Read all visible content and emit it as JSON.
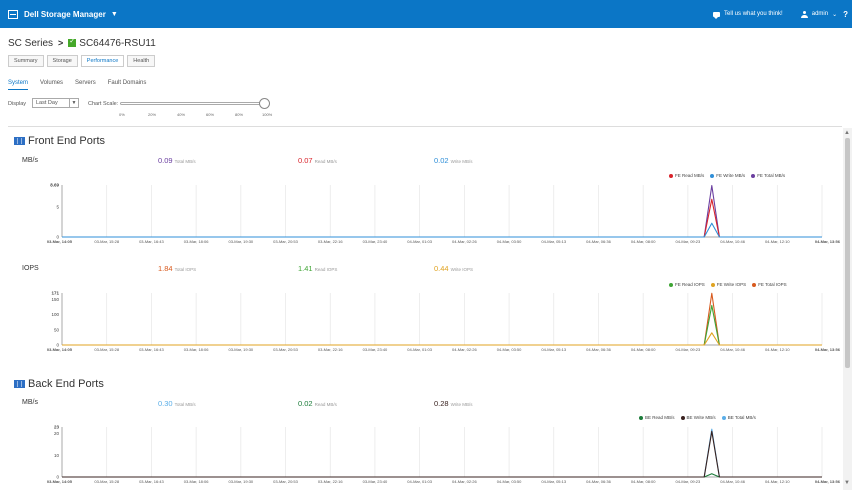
{
  "topbar": {
    "app_title": "Dell Storage Manager",
    "feedback_label": "Tell us what you think!",
    "user_label": "admin",
    "help_label": "?"
  },
  "breadcrumb": {
    "root": "SC Series",
    "system": "SC64476-RSU11"
  },
  "tabs": [
    "Summary",
    "Storage",
    "Performance",
    "Health"
  ],
  "active_tab": "Performance",
  "subtabs": [
    "System",
    "Volumes",
    "Servers",
    "Fault Domains"
  ],
  "active_subtab": "System",
  "controls": {
    "display_label": "Display",
    "display_value": "Last Day",
    "chart_scale_label": "Chart Scale:",
    "scale_ticks": [
      "0%",
      "20%",
      "40%",
      "60%",
      "80%",
      "100%"
    ],
    "scale_value": 1.0
  },
  "sections": {
    "front_end": {
      "title": "Front End Ports"
    },
    "back_end": {
      "title": "Back End Ports"
    }
  },
  "metrics": {
    "fe_mbs": {
      "label": "MB/s",
      "total": "0.09",
      "total_unit": "Total MB/s",
      "read": "0.07",
      "read_unit": "Read MB/s",
      "write": "0.02",
      "write_unit": "Write MB/s"
    },
    "fe_iops": {
      "label": "IOPS",
      "total": "1.84",
      "total_unit": "Total IOPS",
      "read": "1.41",
      "read_unit": "Read IOPS",
      "write": "0.44",
      "write_unit": "Write IOPS"
    },
    "be_mbs": {
      "label": "MB/s",
      "total": "0.30",
      "total_unit": "Total MB/s",
      "read": "0.02",
      "read_unit": "Read MB/s",
      "write": "0.28",
      "write_unit": "Write MB/s"
    }
  },
  "colors": {
    "brand": "#0b76c6",
    "fe_read": "#d9232b",
    "fe_write": "#2f8fd8",
    "fe_total": "#6b3fa0",
    "iops_read": "#3fa535",
    "iops_write": "#e0a321",
    "iops_total": "#d85a1e",
    "be_read": "#1c7c3a",
    "be_write": "#3a2320",
    "be_total": "#5aaee8"
  },
  "chart_data": [
    {
      "type": "line",
      "ylabel": "MB/s",
      "ylim": [
        0,
        8.69
      ],
      "yticks": [
        "8.69",
        "5",
        "0"
      ],
      "ytick_values": [
        8.69,
        5,
        0
      ],
      "x_ticks": [
        "03-Mar, 14:05",
        "03-Mar, 15:28",
        "03-Mar, 16:43",
        "03-Mar, 18:06",
        "03-Mar, 19:30",
        "03-Mar, 20:53",
        "03-Mar, 22:16",
        "03-Mar, 23:40",
        "04-Mar, 01:03",
        "04-Mar, 02:26",
        "04-Mar, 03:50",
        "04-Mar, 05:13",
        "04-Mar, 06:36",
        "04-Mar, 08:00",
        "04-Mar, 09:23",
        "04-Mar, 10:46",
        "04-Mar, 12:10",
        "04-Mar, 13:56"
      ],
      "series": [
        {
          "name": "FE Read MB/s",
          "color_key": "fe_read",
          "points": [
            [
              0,
              0
            ],
            [
              0.845,
              0
            ],
            [
              0.855,
              6.3
            ],
            [
              0.865,
              0
            ],
            [
              1,
              0
            ]
          ]
        },
        {
          "name": "FE Write MB/s",
          "color_key": "fe_write",
          "points": [
            [
              0,
              0
            ],
            [
              0.845,
              0
            ],
            [
              0.855,
              2.3
            ],
            [
              0.865,
              0
            ],
            [
              1,
              0
            ]
          ]
        },
        {
          "name": "FE Total MB/s",
          "color_key": "fe_total",
          "points": [
            [
              0,
              0
            ],
            [
              0.845,
              0
            ],
            [
              0.855,
              8.6
            ],
            [
              0.865,
              0
            ],
            [
              1,
              0
            ]
          ]
        }
      ]
    },
    {
      "type": "line",
      "ylabel": "IOPS",
      "ylim": [
        0,
        171
      ],
      "yticks": [
        "171",
        "150",
        "100",
        "50",
        "0"
      ],
      "ytick_values": [
        171,
        150,
        100,
        50,
        0
      ],
      "x_ticks": [
        "03-Mar, 14:05",
        "03-Mar, 15:28",
        "03-Mar, 16:43",
        "03-Mar, 18:06",
        "03-Mar, 19:30",
        "03-Mar, 20:53",
        "03-Mar, 22:16",
        "03-Mar, 23:40",
        "04-Mar, 01:03",
        "04-Mar, 02:26",
        "04-Mar, 03:50",
        "04-Mar, 05:13",
        "04-Mar, 06:36",
        "04-Mar, 08:00",
        "04-Mar, 09:23",
        "04-Mar, 10:46",
        "04-Mar, 12:10",
        "04-Mar, 13:56"
      ],
      "series": [
        {
          "name": "FE Read IOPS",
          "color_key": "iops_read",
          "points": [
            [
              0,
              0
            ],
            [
              0.845,
              0
            ],
            [
              0.855,
              130
            ],
            [
              0.865,
              0
            ],
            [
              1,
              0
            ]
          ]
        },
        {
          "name": "FE Write IOPS",
          "color_key": "iops_write",
          "points": [
            [
              0,
              0
            ],
            [
              0.845,
              0
            ],
            [
              0.855,
              40
            ],
            [
              0.865,
              0
            ],
            [
              1,
              0
            ]
          ]
        },
        {
          "name": "FE Total IOPS",
          "color_key": "iops_total",
          "points": [
            [
              0,
              0
            ],
            [
              0.845,
              0
            ],
            [
              0.855,
              170
            ],
            [
              0.865,
              0
            ],
            [
              1,
              0
            ]
          ]
        }
      ]
    },
    {
      "type": "line",
      "ylabel": "MB/s",
      "ylim": [
        0,
        23
      ],
      "yticks": [
        "23",
        "20",
        "10",
        "0"
      ],
      "ytick_values": [
        23,
        20,
        10,
        0
      ],
      "x_ticks": [
        "03-Mar, 14:05",
        "03-Mar, 15:28",
        "03-Mar, 16:43",
        "03-Mar, 18:06",
        "03-Mar, 19:30",
        "03-Mar, 20:53",
        "03-Mar, 22:16",
        "03-Mar, 23:40",
        "04-Mar, 01:03",
        "04-Mar, 02:26",
        "04-Mar, 03:50",
        "04-Mar, 05:13",
        "04-Mar, 06:36",
        "04-Mar, 08:00",
        "04-Mar, 09:23",
        "04-Mar, 10:46",
        "04-Mar, 12:10",
        "04-Mar, 13:56"
      ],
      "series": [
        {
          "name": "BE Read MB/s",
          "color_key": "be_read",
          "points": [
            [
              0,
              0
            ],
            [
              0.845,
              0
            ],
            [
              0.855,
              1.5
            ],
            [
              0.865,
              0
            ],
            [
              1,
              0
            ]
          ]
        },
        {
          "name": "BE Write MB/s",
          "color_key": "be_write",
          "points": [
            [
              0,
              0
            ],
            [
              0.845,
              0
            ],
            [
              0.855,
              21
            ],
            [
              0.865,
              0
            ],
            [
              1,
              0
            ]
          ]
        },
        {
          "name": "BE Total MB/s",
          "color_key": "be_total",
          "points": [
            [
              0,
              0
            ],
            [
              0.845,
              0
            ],
            [
              0.855,
              22
            ],
            [
              0.865,
              0
            ],
            [
              1,
              0
            ]
          ]
        }
      ]
    }
  ]
}
